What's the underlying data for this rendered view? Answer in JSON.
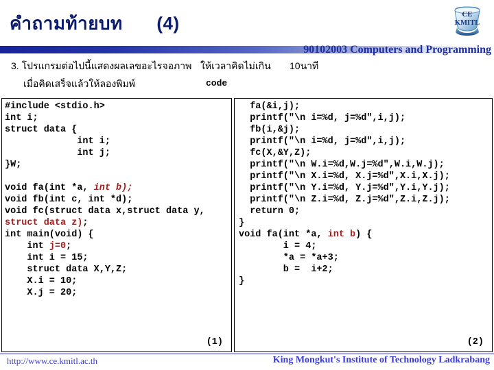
{
  "slide": {
    "title_th": "คำถามท้ายบท",
    "title_number": "(4)",
    "logo_line1": "CE",
    "logo_line2": "KMITL"
  },
  "header": {
    "course": "90102003 Computers and Programming",
    "accent_color": "#1d2f9e",
    "bar_start_color": "#17239b",
    "bar_end_color": "#ffffff"
  },
  "prompt": {
    "line1_part1": "3. โปรแกรมต่อไปนี้แสดงผลเลขอะไรจอภาพ",
    "line1_part2": "ให้เวลาคิดไม่เกิน",
    "line1_part3": "10นาที",
    "line2_part1": "เมื่อคิดเสร็จแล้วให้ลองพิมพ์",
    "line2_part2": "code"
  },
  "panels": {
    "left": {
      "index_label": "(1)",
      "lines": [
        [
          {
            "t": "#include <stdio.h>",
            "c": "black"
          }
        ],
        [
          {
            "t": "int i;",
            "c": "black"
          }
        ],
        [
          {
            "t": "struct data {",
            "c": "black"
          }
        ],
        [
          {
            "t": "             int i;",
            "c": "black"
          }
        ],
        [
          {
            "t": "             int j;",
            "c": "black"
          }
        ],
        [
          {
            "t": "}W;",
            "c": "black"
          }
        ],
        [
          {
            "t": "",
            "c": "black"
          }
        ],
        [
          {
            "t": "void fa(int *a, ",
            "c": "black"
          },
          {
            "t": "int b);",
            "c": "red-italic"
          }
        ],
        [
          {
            "t": "void fb(int c, int *d);",
            "c": "black"
          }
        ],
        [
          {
            "t": "void fc(struct data x,struct data y,",
            "c": "black"
          }
        ],
        [
          {
            "t": "struct data z)",
            "c": "red"
          },
          {
            "t": ";",
            "c": "black"
          }
        ],
        [
          {
            "t": "int main(void) {",
            "c": "black"
          }
        ],
        [
          {
            "t": "    int ",
            "c": "black"
          },
          {
            "t": "j=0",
            "c": "red"
          },
          {
            "t": ";",
            "c": "black"
          }
        ],
        [
          {
            "t": "    int i = 15;",
            "c": "black"
          }
        ],
        [
          {
            "t": "    struct data X,Y,Z;",
            "c": "black"
          }
        ],
        [
          {
            "t": "    X.i = 10;",
            "c": "black"
          }
        ],
        [
          {
            "t": "    X.j = 20;",
            "c": "black"
          }
        ]
      ]
    },
    "right": {
      "index_label": "(2)",
      "lines": [
        [
          {
            "t": "  fa(&i,j);",
            "c": "black"
          }
        ],
        [
          {
            "t": "  printf(\"\\n i=%d, j=%d\",i,j);",
            "c": "black"
          }
        ],
        [
          {
            "t": "  fb(i,&j);",
            "c": "black"
          }
        ],
        [
          {
            "t": "  printf(\"\\n i=%d, j=%d\",i,j);",
            "c": "black"
          }
        ],
        [
          {
            "t": "  fc(X,&Y,Z);",
            "c": "black"
          }
        ],
        [
          {
            "t": "  printf(\"\\n W.i=%d,W.j=%d\",W.i,W.j);",
            "c": "black"
          }
        ],
        [
          {
            "t": "  printf(\"\\n X.i=%d, X.j=%d\",X.i,X.j);",
            "c": "black"
          }
        ],
        [
          {
            "t": "  printf(\"\\n Y.i=%d, Y.j=%d\",Y.i,Y.j);",
            "c": "black"
          }
        ],
        [
          {
            "t": "  printf(\"\\n Z.i=%d, Z.j=%d\",Z.i,Z.j);",
            "c": "black"
          }
        ],
        [
          {
            "t": "  return 0;",
            "c": "black"
          }
        ],
        [
          {
            "t": "}",
            "c": "black"
          }
        ],
        [
          {
            "t": "void fa(int *a, ",
            "c": "black"
          },
          {
            "t": "int b",
            "c": "red"
          },
          {
            "t": ") {",
            "c": "black"
          }
        ],
        [
          {
            "t": "        i = 4;",
            "c": "black"
          }
        ],
        [
          {
            "t": "        *a = *a+3;",
            "c": "black"
          }
        ],
        [
          {
            "t": "        b =  i+2;",
            "c": "black"
          }
        ],
        [
          {
            "t": "}",
            "c": "black"
          }
        ]
      ]
    }
  },
  "footer": {
    "url": "http://www.ce.kmitl.ac.th",
    "institution": "King Mongkut's Institute of Technology Ladkrabang",
    "color": "#3a3ad8"
  }
}
